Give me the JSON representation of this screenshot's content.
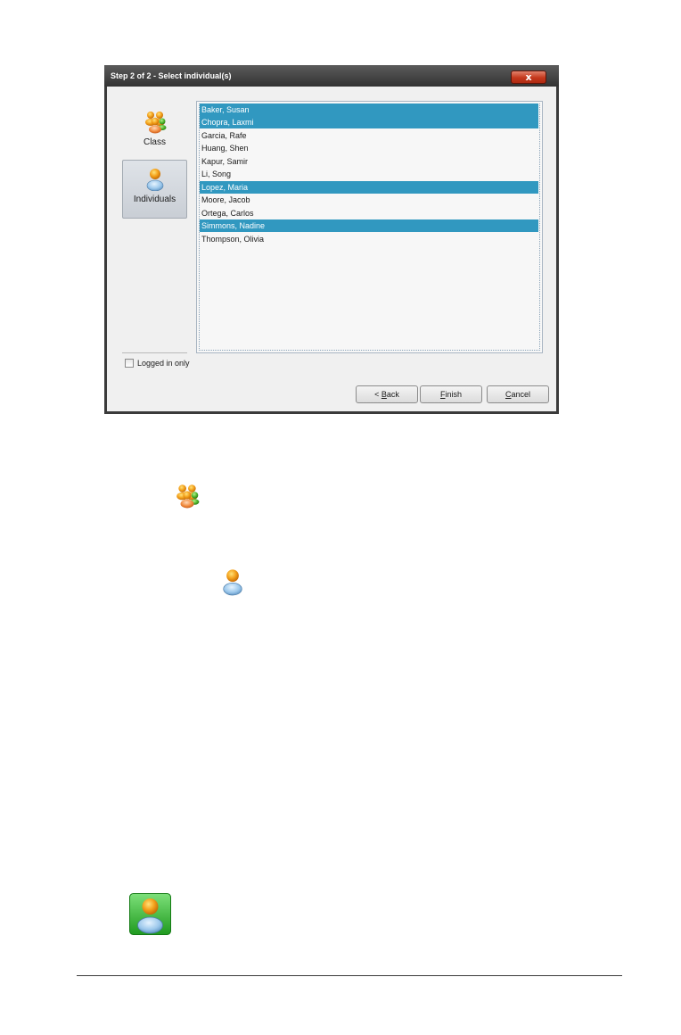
{
  "dialog": {
    "title": "Step 2 of 2 - Select individual(s)",
    "close_label": "x",
    "sidebar": {
      "items": [
        {
          "label": "Class",
          "icon": "class-group-icon",
          "selected": false
        },
        {
          "label": "Individuals",
          "icon": "individual-user-icon",
          "selected": true
        }
      ]
    },
    "students": [
      {
        "name": "Baker, Susan",
        "selected": true
      },
      {
        "name": "Chopra, Laxmi",
        "selected": true
      },
      {
        "name": "Garcia, Rafe",
        "selected": false
      },
      {
        "name": "Huang, Shen",
        "selected": false
      },
      {
        "name": "Kapur, Samir",
        "selected": false
      },
      {
        "name": "Li, Song",
        "selected": false
      },
      {
        "name": "Lopez, Maria",
        "selected": true
      },
      {
        "name": "Moore, Jacob",
        "selected": false
      },
      {
        "name": "Ortega, Carlos",
        "selected": false
      },
      {
        "name": "Simmons, Nadine",
        "selected": true
      },
      {
        "name": "Thompson, Olivia",
        "selected": false
      }
    ],
    "logged_in_only": {
      "label": "Logged in only",
      "checked": false
    },
    "buttons": {
      "back": {
        "prefix": "< ",
        "accel": "B",
        "rest": "ack"
      },
      "finish": {
        "prefix": "",
        "accel": "F",
        "rest": "inish"
      },
      "cancel": {
        "prefix": "",
        "accel": "C",
        "rest": "ancel"
      }
    }
  },
  "colors": {
    "selection": "#3198c0",
    "titlebar": "#3a3a3a",
    "close_button": "#c4381c",
    "green_tile": "#3cb83c"
  },
  "icons": [
    "class-group-icon",
    "individual-user-icon",
    "individual-user-green-icon"
  ]
}
